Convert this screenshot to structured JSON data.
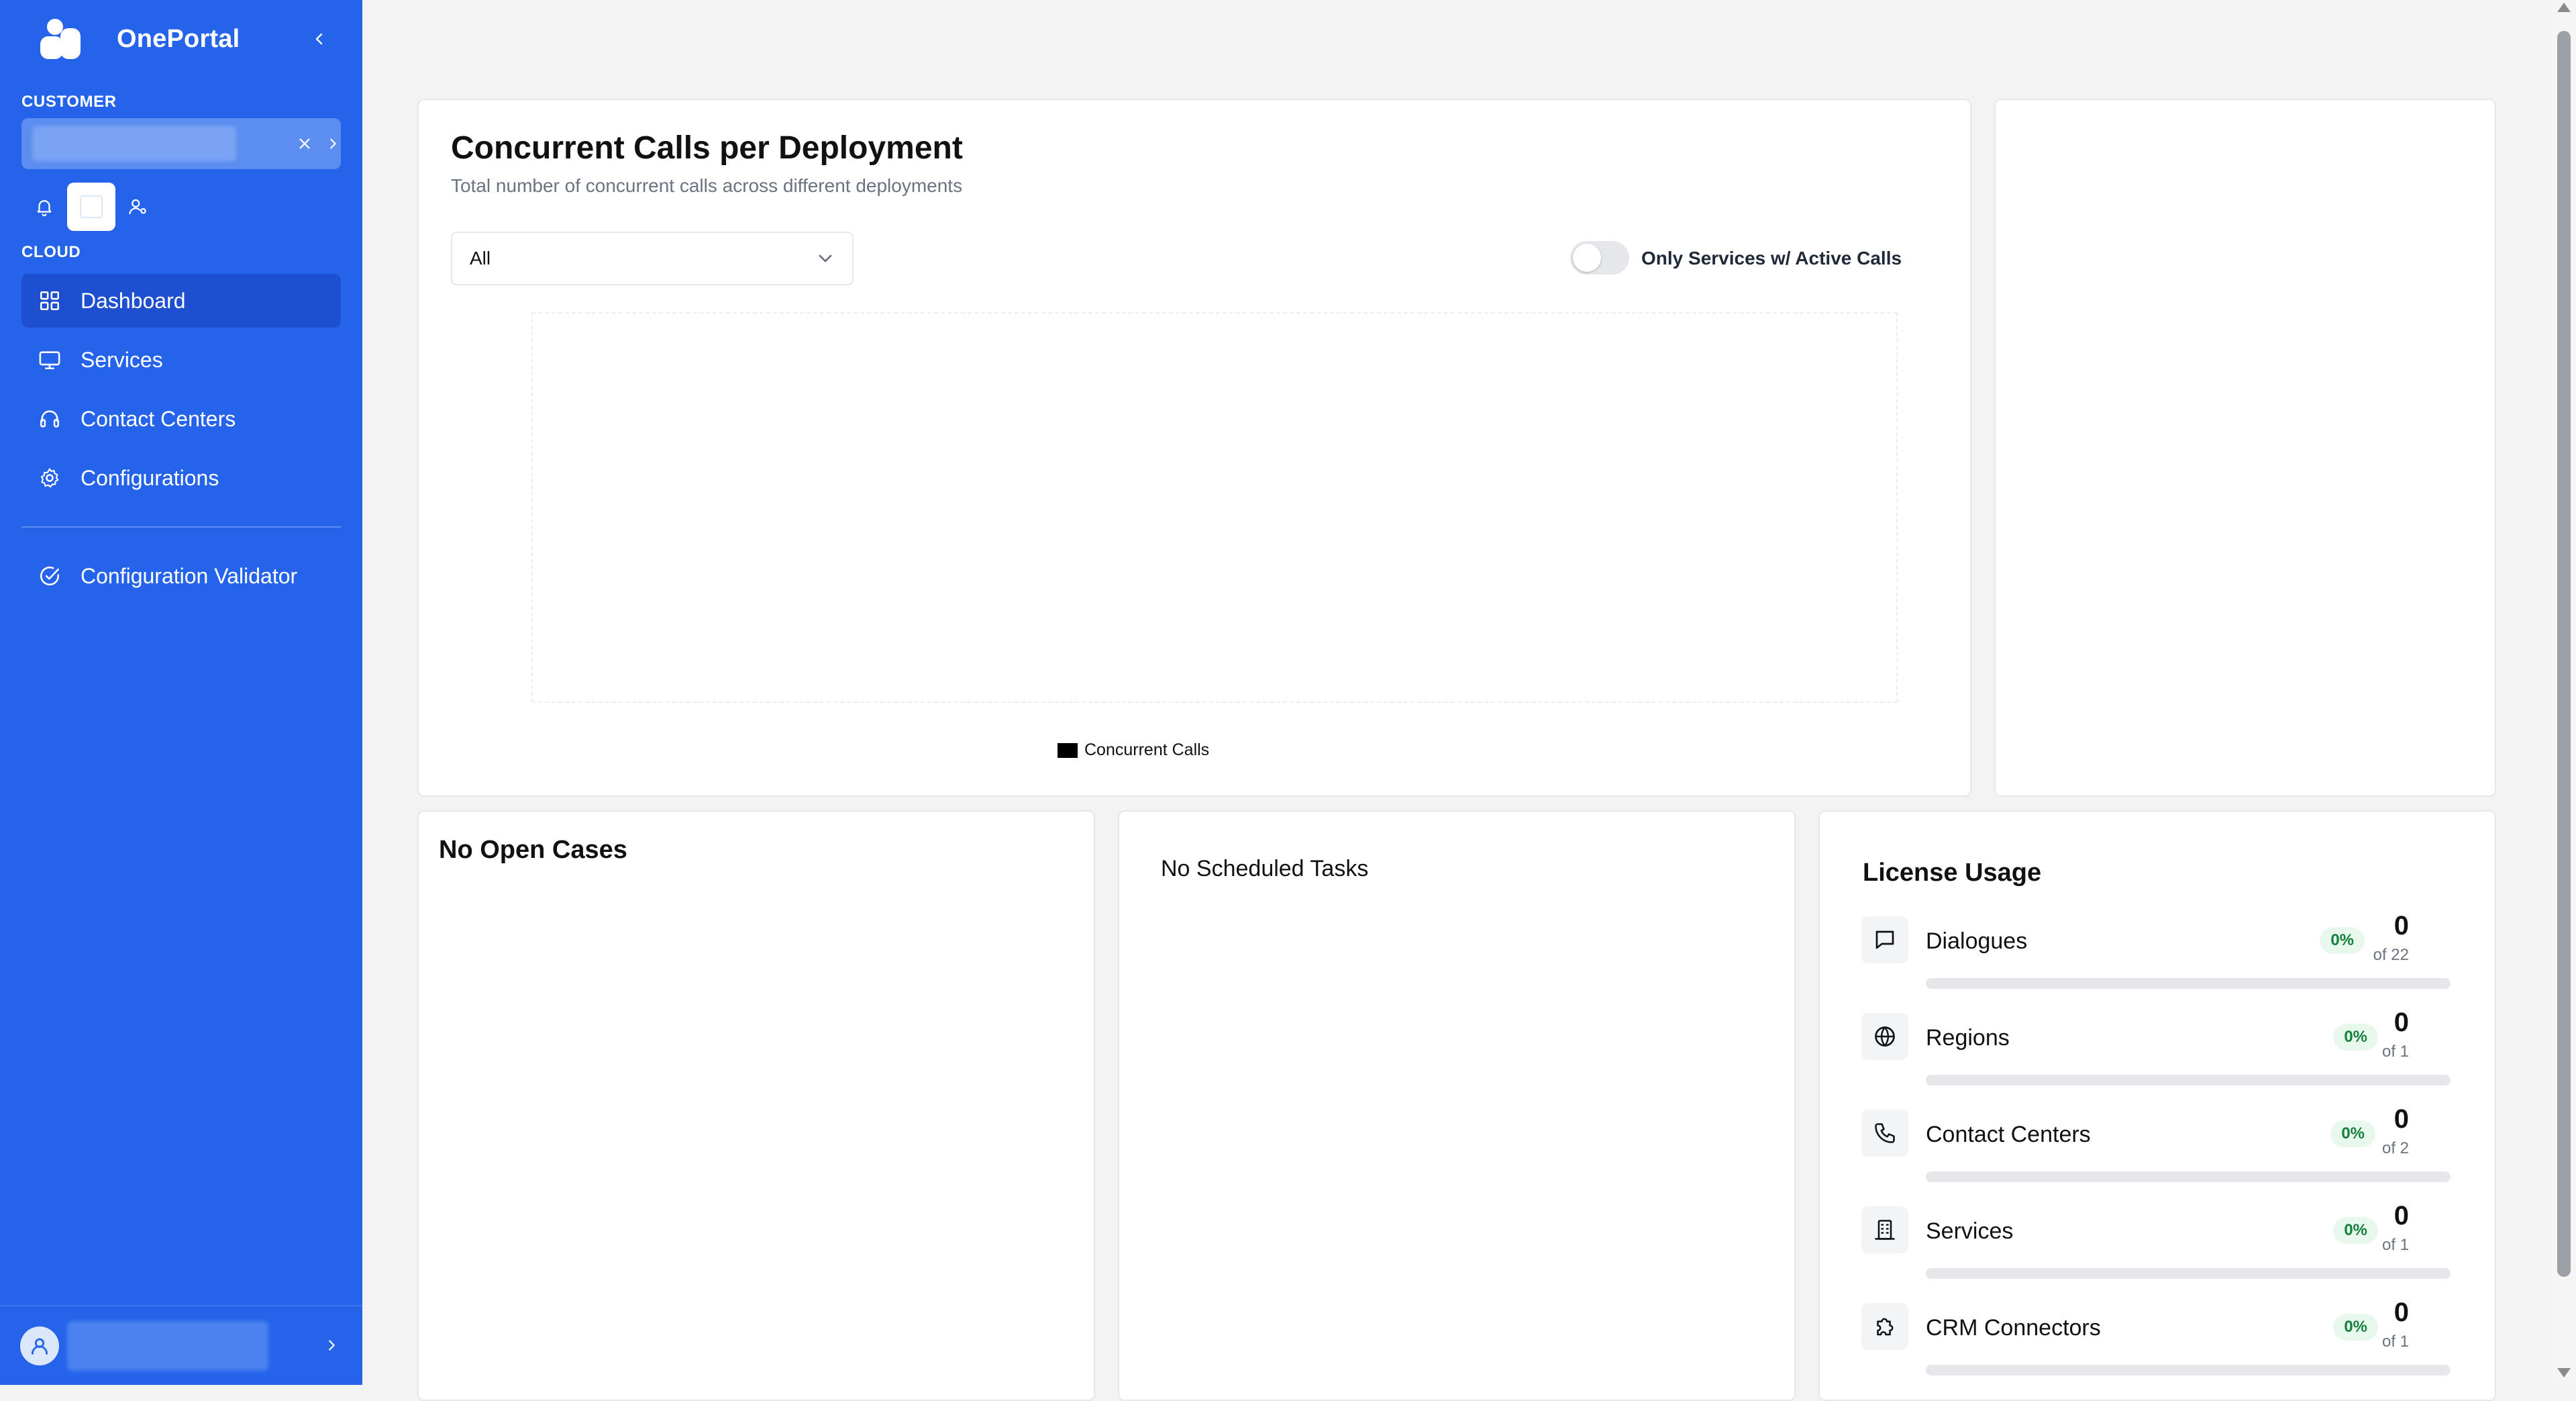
{
  "app": {
    "title": "OnePortal"
  },
  "sidebar": {
    "customer_label": "CUSTOMER",
    "cloud_label": "CLOUD",
    "nav": [
      {
        "label": "Dashboard",
        "icon": "grid-icon",
        "active": true
      },
      {
        "label": "Services",
        "icon": "monitor-icon"
      },
      {
        "label": "Contact Centers",
        "icon": "headset-icon"
      },
      {
        "label": "Configurations",
        "icon": "gear-icon"
      }
    ],
    "validator": {
      "label": "Configuration Validator",
      "icon": "check-circle-icon"
    }
  },
  "chart_card": {
    "title": "Concurrent Calls per Deployment",
    "subtitle": "Total number of concurrent calls across different deployments",
    "select_value": "All",
    "toggle_label": "Only Services w/ Active Calls",
    "toggle_on": false
  },
  "chart_data": {
    "type": "bar",
    "title": "Concurrent Calls per Deployment",
    "subtitle": "Total number of concurrent calls across different deployments",
    "categories": [],
    "series": [
      {
        "name": "Concurrent Calls",
        "values": []
      }
    ],
    "legend": "bottom-center"
  },
  "cases": {
    "title": "No Open Cases"
  },
  "tasks": {
    "title": "No Scheduled Tasks"
  },
  "license": {
    "title": "License Usage",
    "items": [
      {
        "name": "Dialogues",
        "percent": "0%",
        "count": "0",
        "of": "of 22",
        "fill": 0,
        "icon": "chat-icon"
      },
      {
        "name": "Regions",
        "percent": "0%",
        "count": "0",
        "of": "of 1",
        "fill": 0,
        "icon": "globe-icon"
      },
      {
        "name": "Contact Centers",
        "percent": "0%",
        "count": "0",
        "of": "of 2",
        "fill": 0,
        "icon": "phone-icon"
      },
      {
        "name": "Services",
        "percent": "0%",
        "count": "0",
        "of": "of 1",
        "fill": 0,
        "icon": "building-icon"
      },
      {
        "name": "CRM Connectors",
        "percent": "0%",
        "count": "0",
        "of": "of 1",
        "fill": 0,
        "icon": "puzzle-icon"
      }
    ]
  },
  "colors": {
    "sidebar": "#2563eb",
    "active_nav": "#1d4fd0",
    "badge_bg": "#e8f8ec",
    "badge_text": "#15803d"
  }
}
